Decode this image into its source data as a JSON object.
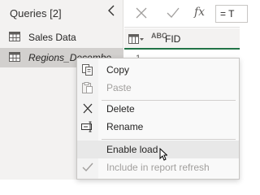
{
  "queries_pane": {
    "title": "Queries [2]",
    "items": [
      {
        "label": "Sales Data",
        "icon": "table-icon"
      },
      {
        "label": "Regions_December",
        "icon": "table-icon",
        "selected": true
      }
    ]
  },
  "formula_bar": {
    "cancel_icon": "close-icon",
    "commit_icon": "check-icon",
    "fx_label": "fx",
    "formula_text": "= T"
  },
  "grid": {
    "column_type_label": "ABC",
    "column_name": "FID",
    "first_row_number": "1"
  },
  "context_menu": {
    "items": [
      {
        "label": "Copy",
        "icon": "copy-icon",
        "enabled": true
      },
      {
        "label": "Paste",
        "icon": "paste-icon",
        "enabled": false
      },
      {
        "label": "Delete",
        "icon": "delete-icon",
        "enabled": true
      },
      {
        "label": "Rename",
        "icon": "rename-icon",
        "enabled": true
      },
      {
        "label": "Enable load",
        "icon": "",
        "enabled": true,
        "hovered": true
      },
      {
        "label": "Include in report refresh",
        "icon": "check-icon",
        "enabled": false
      }
    ]
  },
  "colors": {
    "accent": "#217346",
    "pane_bg": "#f3f2f1",
    "selected_bg": "#d2d0ce",
    "menu_bg": "#f9f9f9"
  }
}
